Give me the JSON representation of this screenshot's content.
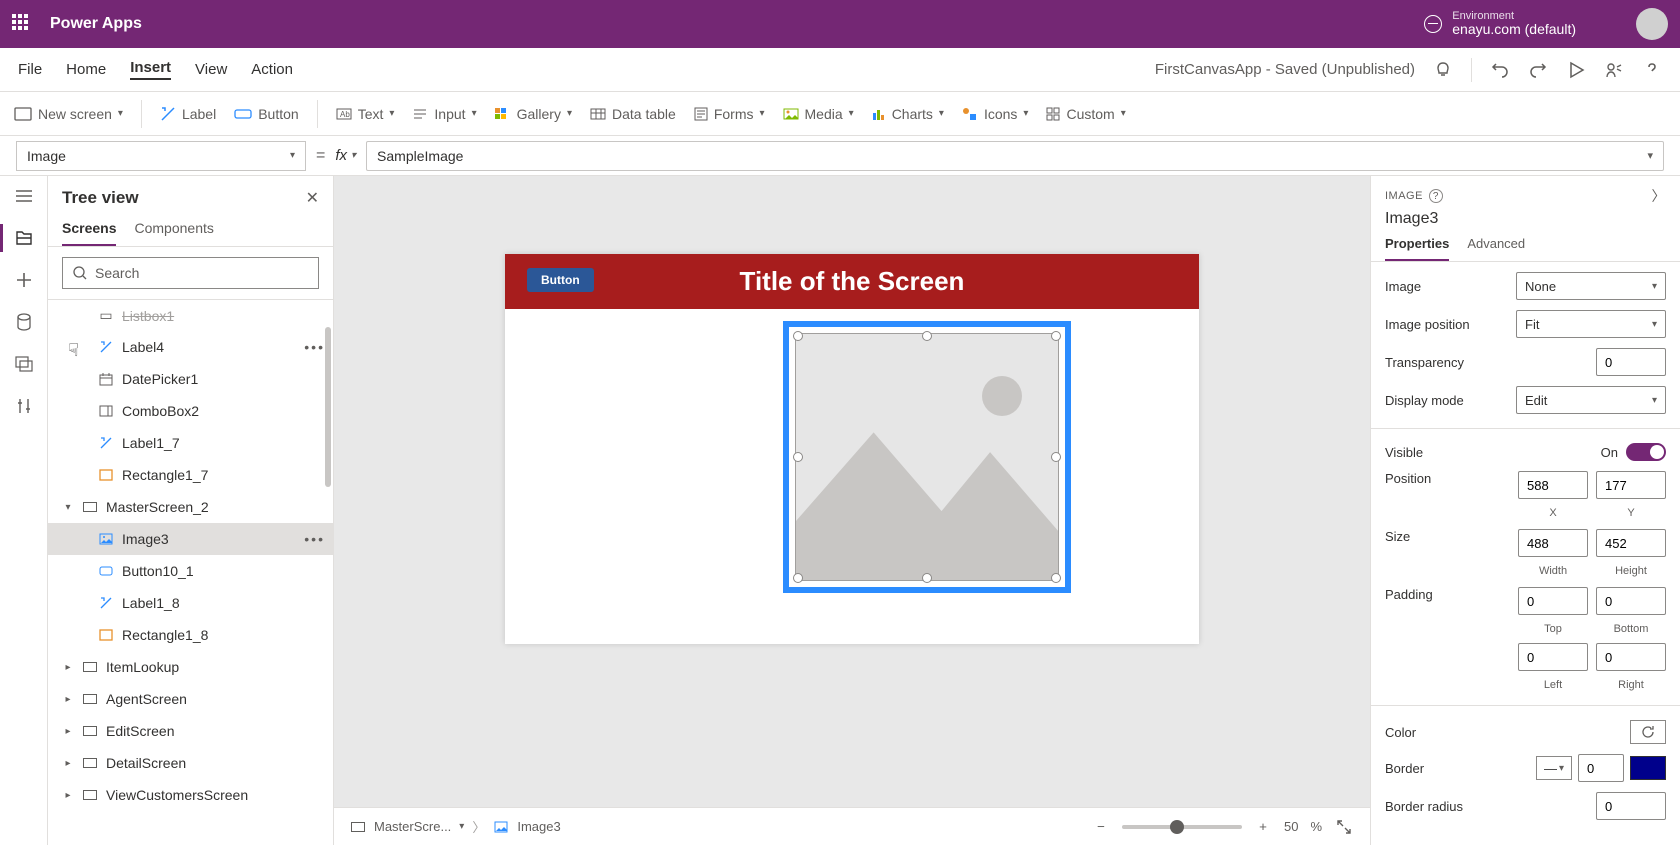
{
  "brand": "Power Apps",
  "env": {
    "label": "Environment",
    "name": "enayu.com (default)"
  },
  "menu": {
    "file": "File",
    "home": "Home",
    "insert": "Insert",
    "view": "View",
    "action": "Action"
  },
  "appStatus": "FirstCanvasApp - Saved (Unpublished)",
  "ribbon": {
    "newscreen": "New screen",
    "label": "Label",
    "button": "Button",
    "text": "Text",
    "input": "Input",
    "gallery": "Gallery",
    "datatable": "Data table",
    "forms": "Forms",
    "media": "Media",
    "charts": "Charts",
    "icons": "Icons",
    "custom": "Custom"
  },
  "formula": {
    "property": "Image",
    "value": "SampleImage"
  },
  "tree": {
    "title": "Tree view",
    "tabs": {
      "screens": "Screens",
      "components": "Components"
    },
    "searchPlaceholder": "Search",
    "nodes": {
      "listbox1": "Listbox1",
      "label4": "Label4",
      "datepicker1": "DatePicker1",
      "combobox2": "ComboBox2",
      "label1_7": "Label1_7",
      "rectangle1_7": "Rectangle1_7",
      "masterscreen2": "MasterScreen_2",
      "image3": "Image3",
      "button10_1": "Button10_1",
      "label1_8": "Label1_8",
      "rectangle1_8": "Rectangle1_8",
      "itemlookup": "ItemLookup",
      "agentscreen": "AgentScreen",
      "editscreen": "EditScreen",
      "detailscreen": "DetailScreen",
      "viewcustomers": "ViewCustomersScreen"
    }
  },
  "canvas": {
    "screenTitle": "Title of the Screen",
    "buttonLabel": "Button"
  },
  "breadcrumb": {
    "screen": "MasterScre...",
    "control": "Image3"
  },
  "zoom": {
    "value": "50",
    "suffix": "%"
  },
  "props": {
    "type": "IMAGE",
    "name": "Image3",
    "tabs": {
      "properties": "Properties",
      "advanced": "Advanced"
    },
    "image": {
      "label": "Image",
      "value": "None"
    },
    "imagePosition": {
      "label": "Image position",
      "value": "Fit"
    },
    "transparency": {
      "label": "Transparency",
      "value": "0"
    },
    "displayMode": {
      "label": "Display mode",
      "value": "Edit"
    },
    "visible": {
      "label": "Visible",
      "value": "On"
    },
    "position": {
      "label": "Position",
      "x": "588",
      "y": "177",
      "xl": "X",
      "yl": "Y"
    },
    "size": {
      "label": "Size",
      "w": "488",
      "h": "452",
      "wl": "Width",
      "hl": "Height"
    },
    "padding": {
      "label": "Padding",
      "t": "0",
      "b": "0",
      "l": "0",
      "r": "0",
      "tl": "Top",
      "bl": "Bottom",
      "ll": "Left",
      "rl": "Right"
    },
    "color": {
      "label": "Color"
    },
    "border": {
      "label": "Border",
      "value": "0"
    },
    "borderRadius": {
      "label": "Border radius",
      "value": "0"
    }
  }
}
